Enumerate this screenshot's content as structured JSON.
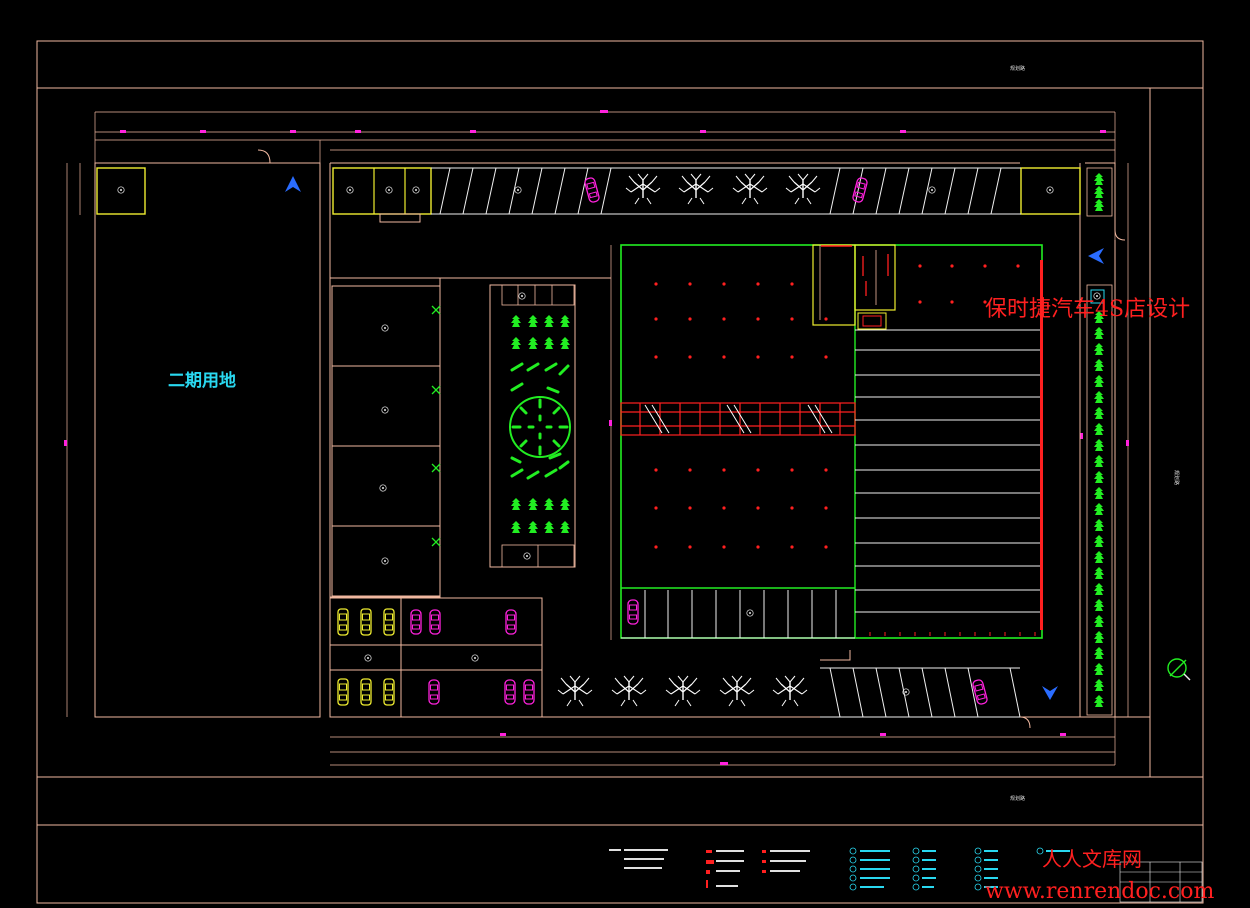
{
  "labels": {
    "phase2_land": "二期用地",
    "design_title": "保时捷汽车4S店设计",
    "watermark_cn": "人人文库网",
    "watermark_url": "www.renrendoc.com"
  },
  "colors": {
    "background": "#000000",
    "outline": "#f0b8a0",
    "green_building": "#22ee22",
    "red": "#ff2020",
    "magenta": "#ff22dd",
    "yellow": "#f0ee30",
    "cyan": "#29d8f0",
    "blue_arrow": "#2a6cff",
    "tree": "#ffffff",
    "shrub": "#22ee22"
  },
  "icons": {
    "north": "north-compass-icon",
    "entry": "entry-arrow-icon",
    "tree": "tree-icon",
    "car": "car-icon",
    "shrub": "shrub-icon"
  }
}
